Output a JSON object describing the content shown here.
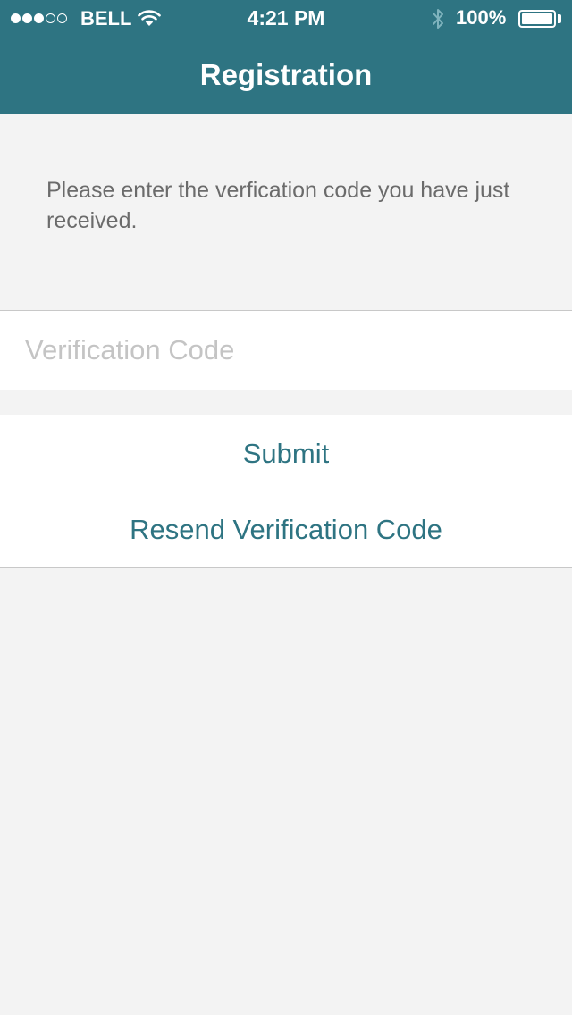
{
  "status_bar": {
    "carrier": "BELL",
    "time": "4:21 PM",
    "battery_percent": "100%",
    "signal_strength": 3,
    "signal_max": 5
  },
  "nav": {
    "title": "Registration"
  },
  "instruction": "Please enter the verfication code you have just received.",
  "verification_input": {
    "placeholder": "Verification Code",
    "value": ""
  },
  "buttons": {
    "submit_label": "Submit",
    "resend_label": "Resend Verification Code"
  },
  "colors": {
    "accent": "#2e7482",
    "background": "#f3f3f3",
    "instruction_text": "#6b6b6b",
    "placeholder_text": "#c4c4c4"
  }
}
